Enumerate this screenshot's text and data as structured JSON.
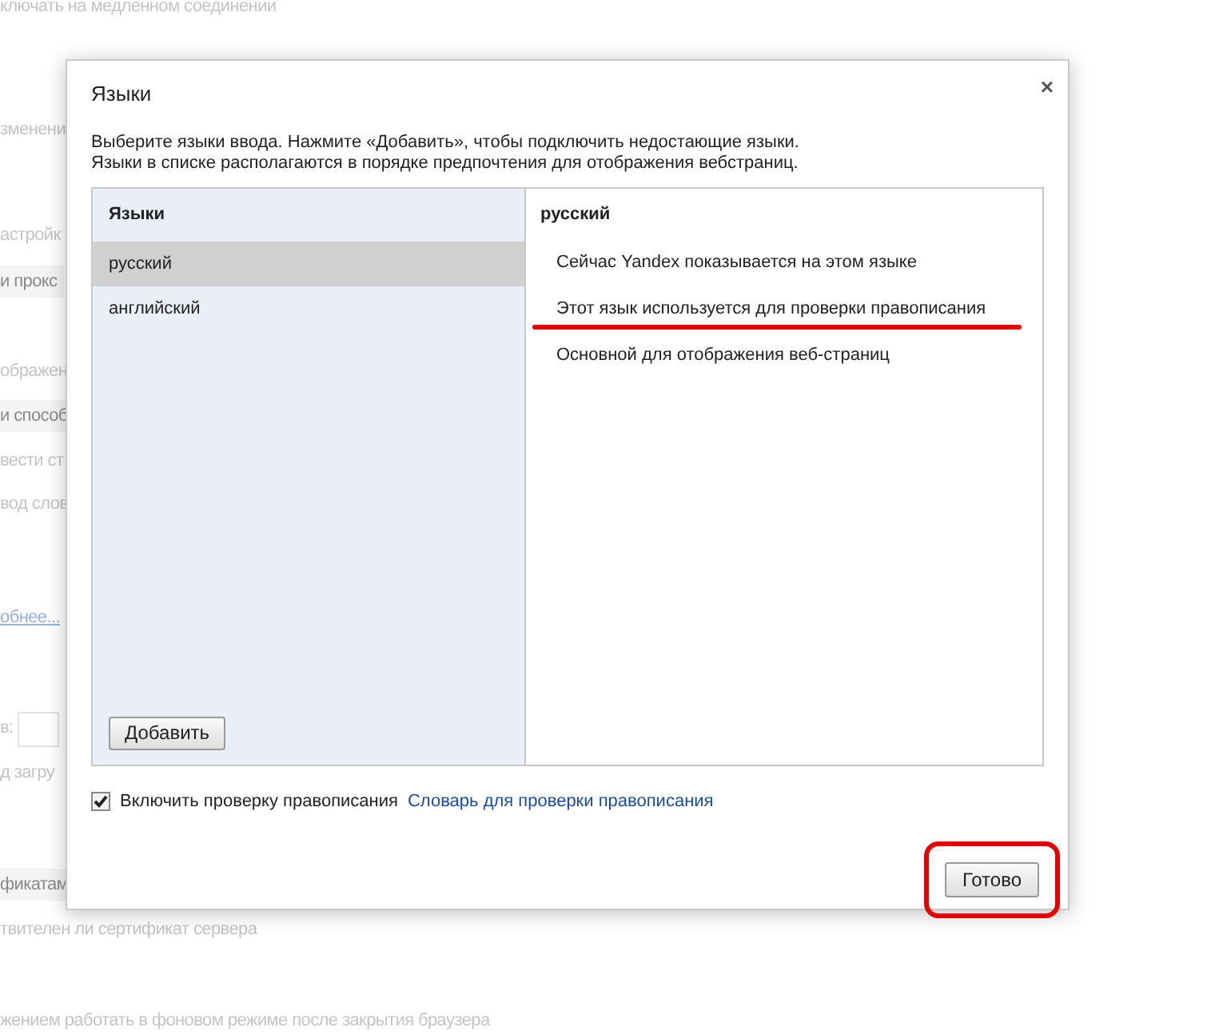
{
  "background": [
    {
      "kind": "text",
      "text": "ключать на медленном соединении"
    },
    {
      "kind": "text",
      "text": "зменени"
    },
    {
      "kind": "text",
      "text": "астройк"
    },
    {
      "kind": "button",
      "text": "и прокс"
    },
    {
      "kind": "text",
      "text": "ображен"
    },
    {
      "kind": "button",
      "text": "и способ"
    },
    {
      "kind": "text",
      "text": "вести ст"
    },
    {
      "kind": "text",
      "text": "вод слов"
    },
    {
      "kind": "link",
      "text": "обнее..."
    },
    {
      "kind": "field",
      "text": "в:"
    },
    {
      "kind": "text",
      "text": "д загру"
    },
    {
      "kind": "button",
      "text": "фикатам"
    },
    {
      "kind": "text",
      "text": "твителен ли сертификат сервера"
    },
    {
      "kind": "text",
      "text": "жением работать в фоновом режиме после закрытия браузера"
    }
  ],
  "dialog": {
    "title": "Языки",
    "close": "×",
    "description": [
      "Выберите языки ввода. Нажмите «Добавить», чтобы подключить недостающие языки.",
      "Языки в списке располагаются в порядке предпочтения для отображения вебстраниц."
    ],
    "languages": {
      "heading": "Языки",
      "items": [
        {
          "label": "русский",
          "selected": true
        },
        {
          "label": "английский",
          "selected": false
        }
      ],
      "add_button": "Добавить"
    },
    "details": {
      "heading": "русский",
      "items": [
        "Сейчас Yandex показывается на этом языке",
        "Этот язык используется для проверки правописания",
        "Основной для отображения веб-страниц"
      ]
    },
    "spellcheck": {
      "label": "Включить проверку правописания",
      "checked": true,
      "link": "Словарь для проверки правописания"
    },
    "done_button": "Готово"
  }
}
